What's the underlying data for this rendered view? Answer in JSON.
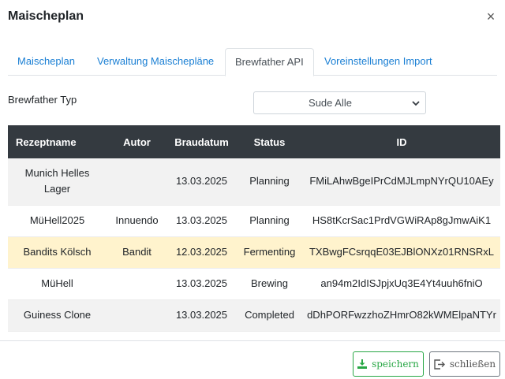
{
  "modal": {
    "title": "Maischeplan",
    "close_symbol": "×"
  },
  "tabs": [
    {
      "label": "Maischeplan",
      "active": false
    },
    {
      "label": "Verwaltung Maischepläne",
      "active": false
    },
    {
      "label": "Brewfather API",
      "active": true
    },
    {
      "label": "Voreinstellungen Import",
      "active": false
    }
  ],
  "filter": {
    "label": "Brewfather Typ",
    "selected": "Sude Alle"
  },
  "table": {
    "headers": [
      "Rezeptname",
      "Autor",
      "Braudatum",
      "Status",
      "ID"
    ],
    "rows": [
      {
        "name": "Munich Helles Lager",
        "author": "",
        "date": "13.03.2025",
        "status": "Planning",
        "id": "FMiLAhwBgeIPrCdMJLmpNYrQU10AEy"
      },
      {
        "name": "MüHell2025",
        "author": "Innuendo",
        "date": "13.03.2025",
        "status": "Planning",
        "id": "HS8tKcrSac1PrdVGWiRAp8gJmwAiK1"
      },
      {
        "name": "Bandits Kölsch",
        "author": "Bandit",
        "date": "12.03.2025",
        "status": "Fermenting",
        "id": "TXBwgFCsrqqE03EJBlONXz01RNSRxL"
      },
      {
        "name": "MüHell",
        "author": "",
        "date": "13.03.2025",
        "status": "Brewing",
        "id": "an94m2IdISJpjxUq3E4Yt4uuh6fniO"
      },
      {
        "name": "Guiness Clone",
        "author": "",
        "date": "13.03.2025",
        "status": "Completed",
        "id": "dDhPORFwzzhoZHmrO82kWMElpaNTYr"
      }
    ]
  },
  "footer": {
    "save_label": "speichern",
    "close_label": "schließen"
  },
  "colors": {
    "accent": "#1a7fd4",
    "header_bg": "#343a40",
    "highlight_row": "#fff3cd",
    "save": "#28a745",
    "close": "#6c757d"
  },
  "icons": {
    "close": "close-icon",
    "dropdown": "chevron-down-icon",
    "save": "download-icon",
    "close_button": "exit-icon"
  }
}
